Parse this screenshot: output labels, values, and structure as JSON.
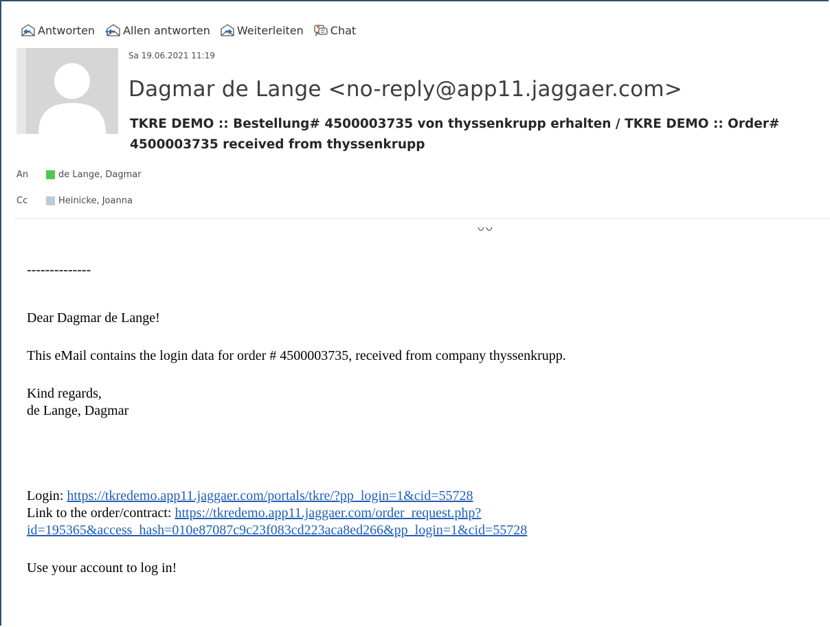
{
  "toolbar": {
    "reply_label": "Antworten",
    "reply_all_label": "Allen antworten",
    "forward_label": "Weiterleiten",
    "chat_label": "Chat"
  },
  "header": {
    "date": "Sa 19.06.2021 11:19",
    "sender": "Dagmar de Lange <no-reply@app11.jaggaer.com>",
    "subject": "TKRE DEMO :: Bestellung# 4500003735 von thyssenkrupp erhalten / TKRE DEMO :: Order# 4500003735 received from thyssenkrupp",
    "to_label": "An",
    "to_name": "de Lange, Dagmar",
    "to_color": "#4ec94e",
    "cc_label": "Cc",
    "cc_name": "Heinicke, Joanna",
    "cc_color": "#b8cdd8"
  },
  "body": {
    "separator": "--------------",
    "greeting": "Dear Dagmar de Lange!",
    "message": "This eMail contains the login data for order # 4500003735, received from company thyssenkrupp.",
    "closing": "Kind regards,",
    "signature": "de Lange, Dagmar",
    "login_label": "Login: ",
    "login_url": "https://tkredemo.app11.jaggaer.com/portals/tkre/?pp_login=1&cid=55728",
    "order_label": "Link to the order/contract: ",
    "order_url_part1": "https://tkredemo.app11.jaggaer.com/order_request.php?",
    "order_url_part2": "id=195365&access_hash=010e87087c9c23f083cd223aca8ed266&pp_login=1&cid=55728",
    "footer": "Use your account to log in!"
  },
  "icons": [
    "reply-icon",
    "reply-all-icon",
    "forward-icon",
    "chat-icon",
    "avatar-icon"
  ],
  "colors": {
    "link": "#1f5eb8",
    "frame": "#2f4f74"
  }
}
